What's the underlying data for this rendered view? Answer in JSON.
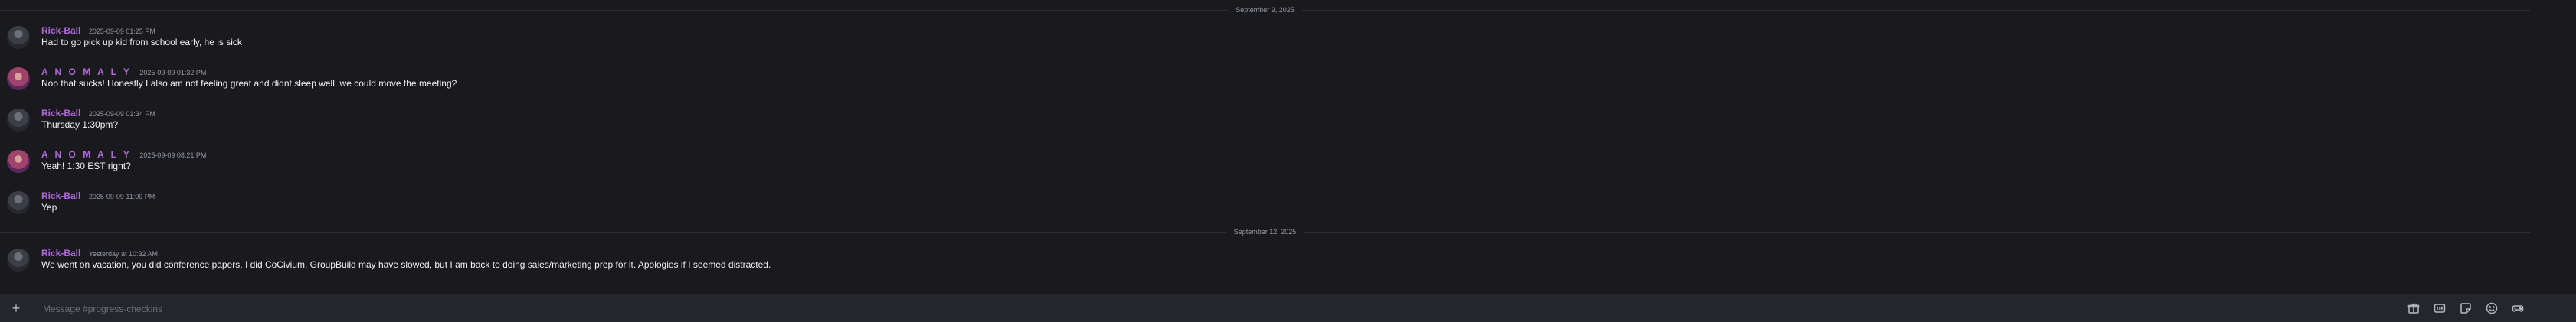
{
  "dividers": [
    {
      "label": "September 9, 2025"
    },
    {
      "label": "September 12, 2025"
    }
  ],
  "messages": [
    {
      "author": "Rick-Ball",
      "time": "2025-09-09 01:25 PM",
      "text": "Had to go pick up kid from school early, he is sick",
      "avatar": "rick"
    },
    {
      "author": "A N O M A L Y",
      "time": "2025-09-09 01:32 PM",
      "text": "Noo that sucks! Honestly I also am not feeling great and didnt sleep well, we could move the meeting?",
      "avatar": "anomaly"
    },
    {
      "author": "Rick-Ball",
      "time": "2025-09-09 01:34 PM",
      "text": "Thursday 1:30pm?",
      "avatar": "rick"
    },
    {
      "author": "A N O M A L Y",
      "time": "2025-09-09 08:21 PM",
      "text": "Yeah! 1:30 EST right?",
      "avatar": "anomaly"
    },
    {
      "author": "Rick-Ball",
      "time": "2025-09-09 11:09 PM",
      "text": "Yep",
      "avatar": "rick"
    },
    {
      "author": "Rick-Ball",
      "time": "Yesterday at 10:32 AM",
      "text": "We went on vacation, you did conference papers, I did CoCivium, GroupBuild may have slowed, but I am back to doing sales/marketing prep for it.  Apologies if I seemed distracted.",
      "avatar": "rick"
    }
  ],
  "composer": {
    "placeholder": "Message #progress-checkins",
    "value": ""
  },
  "toolbar_icons": [
    "gift-icon",
    "gif-icon",
    "sticker-icon",
    "emoji-icon",
    "apps-icon"
  ],
  "colors": {
    "background": "#1a1a1e",
    "author": "#b06ad9",
    "timestamp": "#949ba4",
    "composer": "#25262b"
  }
}
